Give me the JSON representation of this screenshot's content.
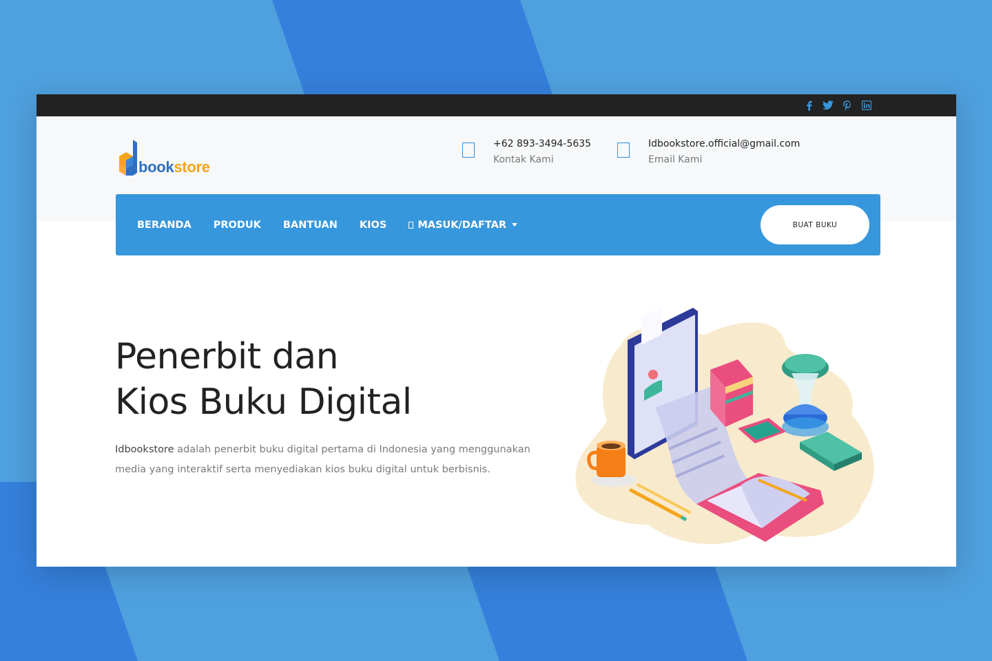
{
  "colors": {
    "accent": "#3797dc",
    "topbar": "#222222",
    "header_bg": "#f6f8fa",
    "logo_blue": "#2f6fc0",
    "logo_orange": "#f4a51c"
  },
  "topbar": {
    "social": [
      "facebook-icon",
      "twitter-icon",
      "pinterest-icon",
      "linkedin-icon"
    ]
  },
  "logo": {
    "mark": "Id",
    "part1": "book",
    "part2": "store"
  },
  "contacts": {
    "phone": {
      "value": "+62 893-3494-5635",
      "label": "Kontak Kami",
      "icon": "phone-icon"
    },
    "email": {
      "value": "Idbookstore.official@gmail.com",
      "label": "Email Kami",
      "icon": "mail-icon"
    }
  },
  "nav": {
    "items": [
      {
        "label": "BERANDA"
      },
      {
        "label": "PRODUK"
      },
      {
        "label": "BANTUAN"
      },
      {
        "label": "KIOS"
      },
      {
        "label": "MASUK/DAFTAR",
        "icon": "user-icon",
        "dropdown": true
      }
    ],
    "cta": "BUAT BUKU"
  },
  "hero": {
    "title_line1": "Penerbit dan",
    "title_line2": "Kios Buku Digital",
    "desc_brand": "Idbookstore",
    "desc_rest": " adalah penerbit buku digital pertama di Indonesia yang menggunakan media yang interaktif serta menyediakan kios buku digital untuk berbisnis."
  }
}
